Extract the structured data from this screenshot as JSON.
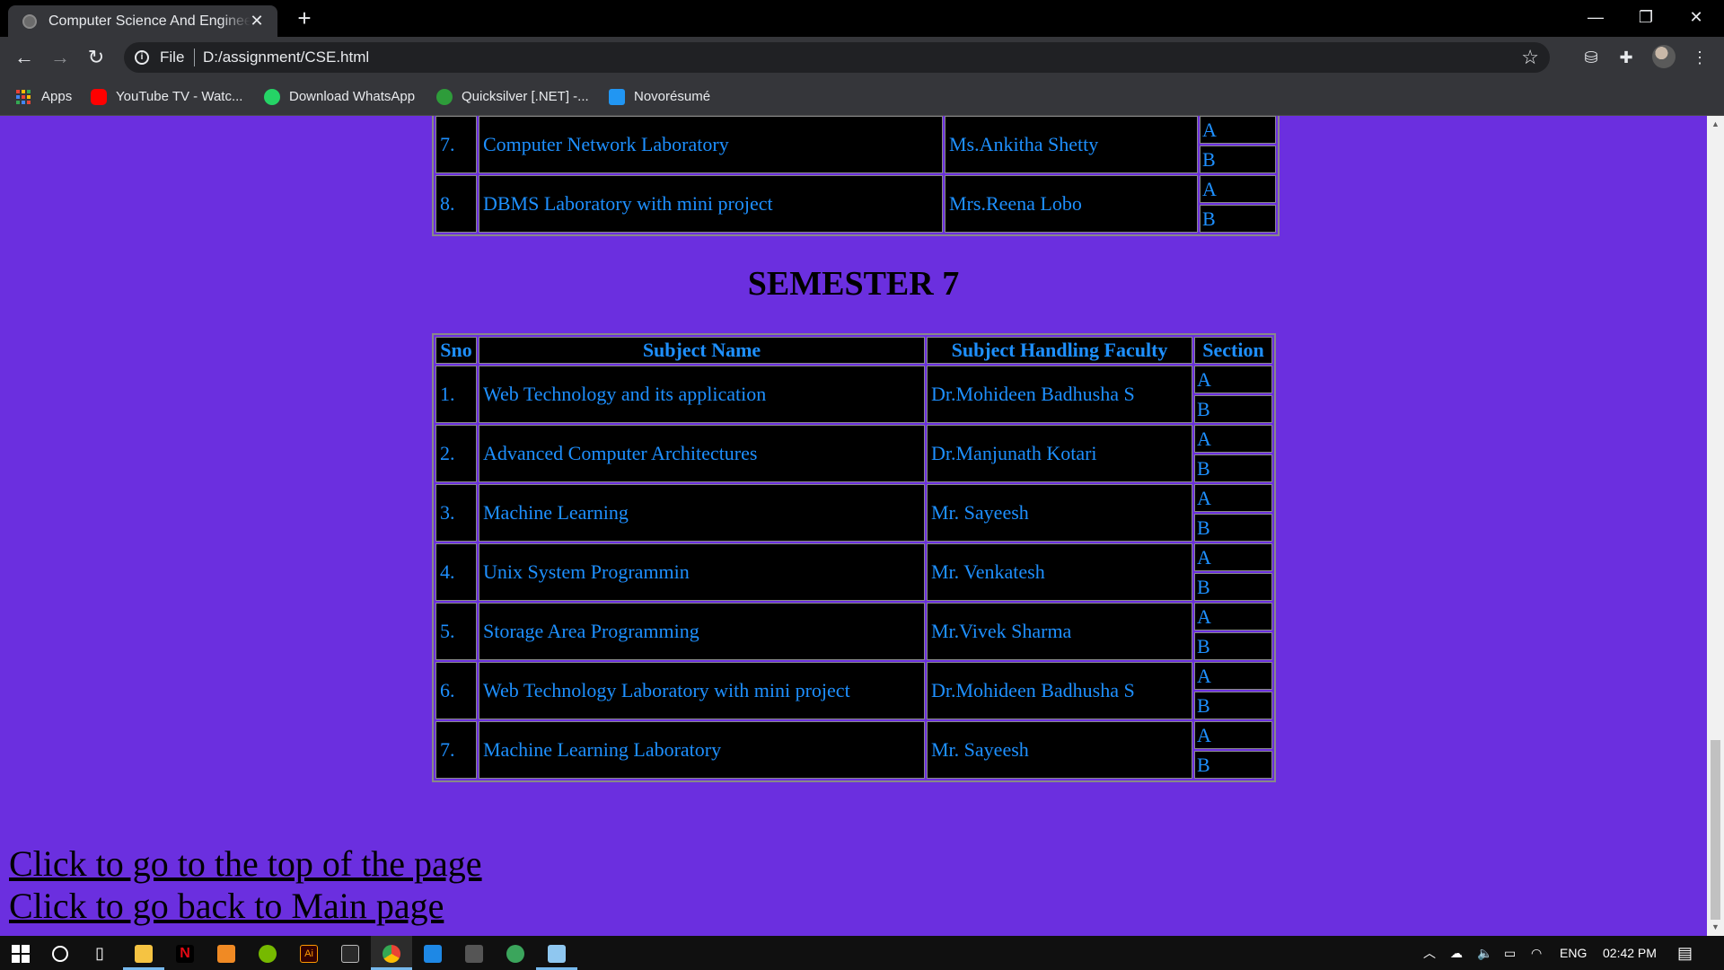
{
  "browser": {
    "tab_title": "Computer Science And Engineering",
    "address_scheme": "File",
    "address_url": "D:/assignment/CSE.html",
    "bookmarks": [
      {
        "label": "Apps",
        "icon": "apps-grid-icon"
      },
      {
        "label": "YouTube TV - Watc...",
        "icon": "youtube-icon",
        "color": "#ff0000"
      },
      {
        "label": "Download WhatsApp",
        "icon": "whatsapp-icon",
        "color": "#25d366"
      },
      {
        "label": "Quicksilver [.NET] -...",
        "icon": "quicksilver-icon",
        "color": "#2e9c3a"
      },
      {
        "label": "Novorésumé",
        "icon": "novoresume-icon",
        "color": "#2196f3"
      }
    ]
  },
  "page": {
    "background": "#6b2fdf",
    "cell_text_color": "#1e90ff",
    "prev_rows": [
      {
        "sno": "7.",
        "subject": "Computer Network Laboratory",
        "faculty": "Ms.Ankitha Shetty",
        "sections": [
          "A",
          "B"
        ]
      },
      {
        "sno": "8.",
        "subject": "DBMS Laboratory with mini project",
        "faculty": "Mrs.Reena Lobo",
        "sections": [
          "A",
          "B"
        ]
      }
    ],
    "semester7": {
      "heading": "SEMESTER 7",
      "headers": {
        "sno": "Sno",
        "subject": "Subject Name",
        "faculty": "Subject Handling Faculty",
        "section": "Section"
      },
      "rows": [
        {
          "sno": "1.",
          "subject": "Web Technology and its application",
          "faculty": "Dr.Mohideen Badhusha S",
          "sections": [
            "A",
            "B"
          ]
        },
        {
          "sno": "2.",
          "subject": "Advanced Computer Architectures",
          "faculty": "Dr.Manjunath Kotari",
          "sections": [
            "A",
            "B"
          ]
        },
        {
          "sno": "3.",
          "subject": "Machine Learning",
          "faculty": "Mr. Sayeesh",
          "sections": [
            "A",
            "B"
          ]
        },
        {
          "sno": "4.",
          "subject": "Unix System Programmin",
          "faculty": "Mr. Venkatesh",
          "sections": [
            "A",
            "B"
          ]
        },
        {
          "sno": "5.",
          "subject": "Storage Area Programming",
          "faculty": "Mr.Vivek Sharma",
          "sections": [
            "A",
            "B"
          ]
        },
        {
          "sno": "6.",
          "subject": "Web Technology Laboratory with mini project",
          "faculty": "Dr.Mohideen Badhusha S",
          "sections": [
            "A",
            "B"
          ]
        },
        {
          "sno": "7.",
          "subject": "Machine Learning Laboratory",
          "faculty": "Mr. Sayeesh",
          "sections": [
            "A",
            "B"
          ]
        }
      ]
    },
    "links": {
      "top": "Click to go to the top of the page",
      "main": "Click to go back to Main page"
    }
  },
  "taskbar": {
    "language": "ENG",
    "time": "02:42 PM"
  }
}
